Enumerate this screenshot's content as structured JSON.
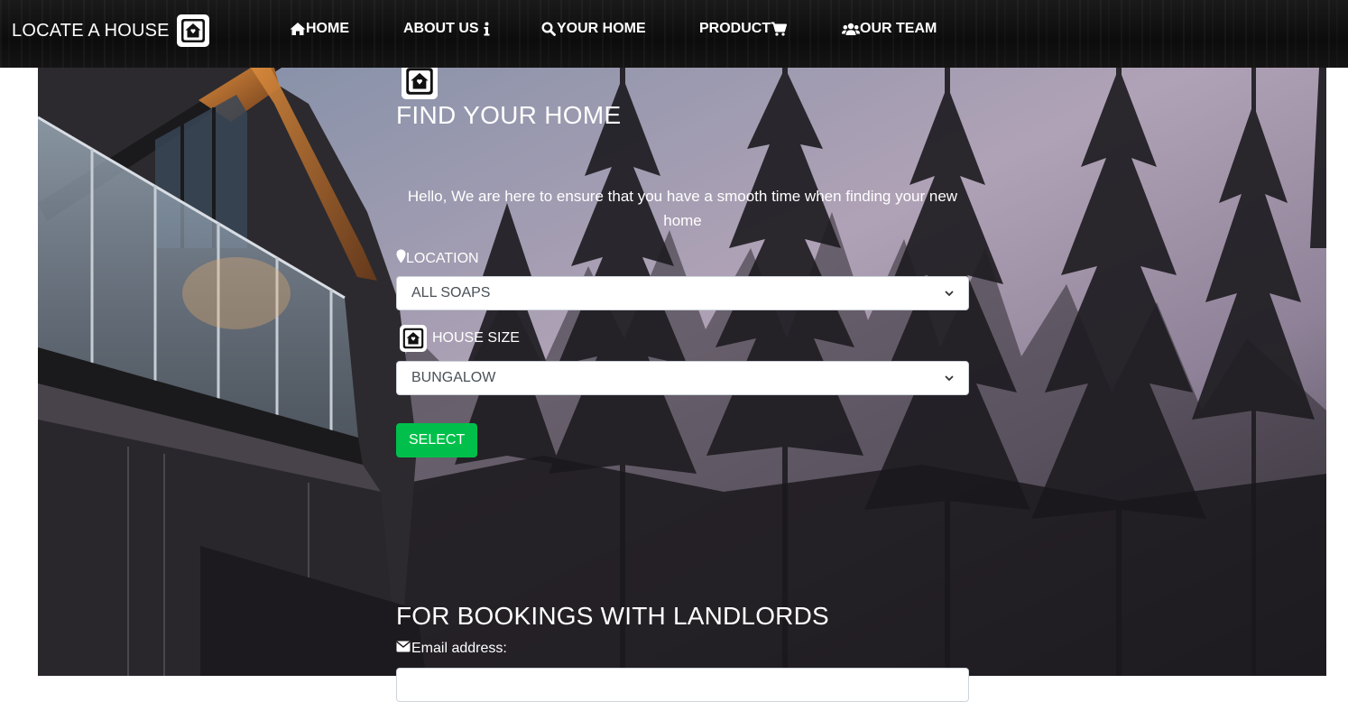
{
  "brand": {
    "name": "LOCATE A HOUSE",
    "icon": "house-icon"
  },
  "nav": {
    "items": [
      {
        "label": "HOME",
        "icon": "home-icon"
      },
      {
        "label": "ABOUT US",
        "icon": "info-icon"
      },
      {
        "label": "YOUR HOME",
        "icon": "search-icon"
      },
      {
        "label": "PRODUCT",
        "icon": "cart-icon"
      },
      {
        "label": "OUR TEAM",
        "icon": "users-icon"
      }
    ]
  },
  "finder": {
    "icon": "house-icon",
    "title": "FIND YOUR HOME",
    "intro": "Hello, We are here to ensure that you have a smooth time when finding your new home",
    "location": {
      "icon": "map-marker-icon",
      "label": "LOCATION",
      "selected": "ALL SOAPS"
    },
    "house_size": {
      "icon": "house-icon",
      "label": "HOUSE SIZE",
      "selected": "BUNGALOW"
    },
    "submit_label": "SELECT"
  },
  "bookings": {
    "title": "FOR BOOKINGS WITH LANDLORDS",
    "email": {
      "icon": "envelope-icon",
      "label": "Email address:",
      "value": ""
    }
  },
  "colors": {
    "accent_button": "#00c04b",
    "navbar": "#111111",
    "text_on_dark": "#ffffff"
  }
}
